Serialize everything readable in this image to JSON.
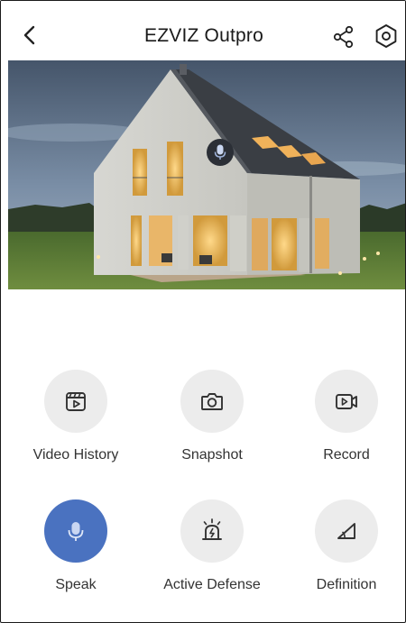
{
  "header": {
    "title": "EZVIZ Outpro",
    "back_icon": "chevron-left-icon",
    "share_icon": "share-icon",
    "settings_icon": "settings-hexagon-icon"
  },
  "live_view": {
    "mic_icon": "microphone-icon",
    "microphone_active": true
  },
  "controls": [
    {
      "id": "video-history",
      "label": "Video History",
      "icon": "video-history-icon",
      "active": false
    },
    {
      "id": "snapshot",
      "label": "Snapshot",
      "icon": "camera-icon",
      "active": false
    },
    {
      "id": "record",
      "label": "Record",
      "icon": "record-video-icon",
      "active": false
    },
    {
      "id": "speak",
      "label": "Speak",
      "icon": "microphone-icon",
      "active": true
    },
    {
      "id": "active-defense",
      "label": "Active Defense",
      "icon": "siren-icon",
      "active": false
    },
    {
      "id": "definition",
      "label": "Definition",
      "icon": "definition-icon",
      "active": false
    }
  ],
  "colors": {
    "accent": "#4a72c0",
    "button_bg": "#ececec",
    "icon_stroke": "#333333"
  }
}
